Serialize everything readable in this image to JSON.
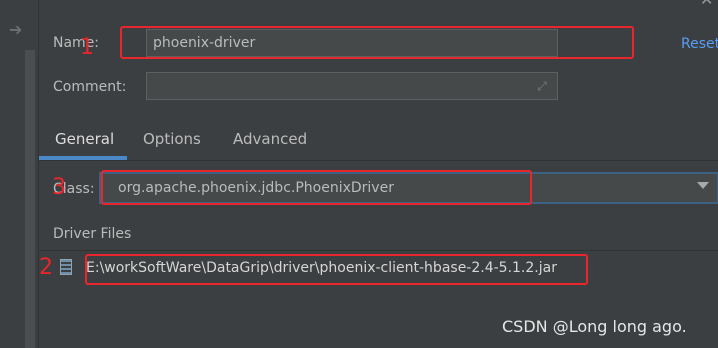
{
  "form": {
    "name_label": "Name:",
    "name_value": "phoenix-driver",
    "comment_label": "Comment:",
    "comment_value": "",
    "reset_label": "Reset"
  },
  "tabs": [
    {
      "label": "General",
      "active": true
    },
    {
      "label": "Options",
      "active": false
    },
    {
      "label": "Advanced",
      "active": false
    }
  ],
  "general": {
    "class_label": "Class:",
    "class_value": "org.apache.phoenix.jdbc.PhoenixDriver",
    "driver_files_label": "Driver Files",
    "driver_files": [
      {
        "path": "E:\\workSoftWare\\DataGrip\\driver\\phoenix-client-hbase-2.4-5.1.2.jar",
        "icon": "jar-icon"
      }
    ]
  },
  "annotations": {
    "marks": [
      "1",
      "3",
      "2"
    ],
    "color": "#e8262c"
  },
  "watermark": "CSDN @Long long ago.",
  "icons": {
    "back": "arrow-right-icon",
    "expand": "expand-icon",
    "dropdown": "chevron-down-icon",
    "close": "close-icon"
  },
  "colors": {
    "background": "#3c3f41",
    "field": "#45494a",
    "accent": "#4a88c7",
    "link": "#589df6"
  }
}
